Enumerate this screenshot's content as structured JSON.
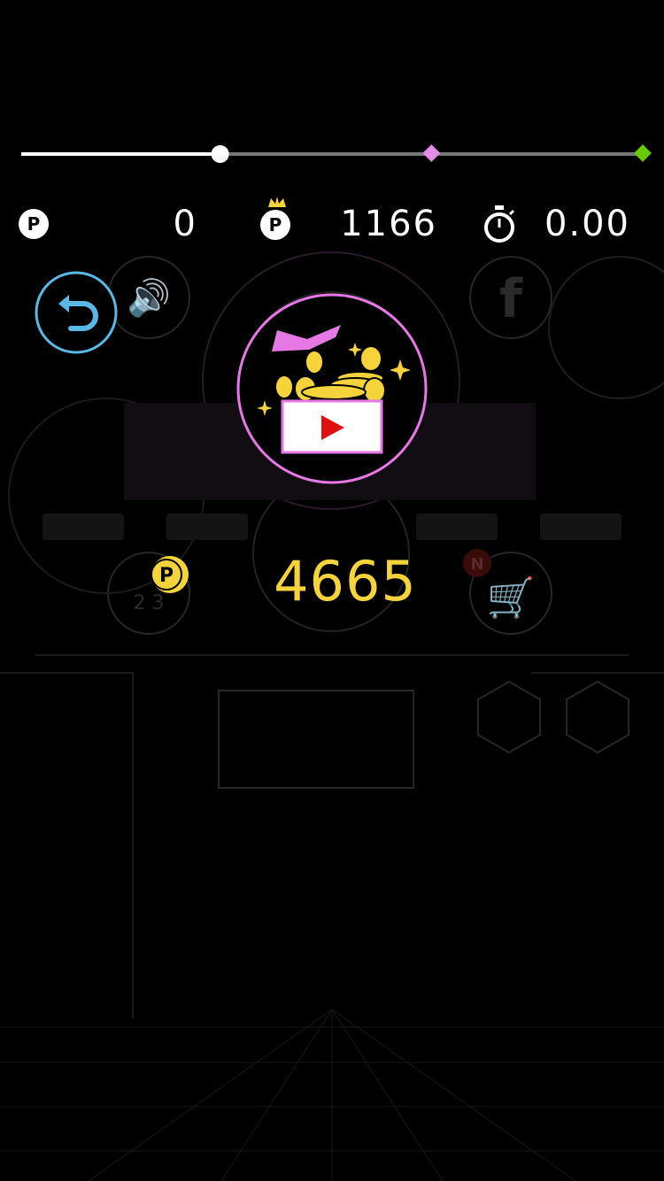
{
  "progress": {
    "value": 0.32,
    "marker_mid": 0.66,
    "marker_end": 1.0,
    "track_color": "#777777",
    "fill_color": "#ffffff",
    "mid_color": "#e68ce6",
    "end_color": "#66cc00"
  },
  "stats": {
    "points": "0",
    "best_points": "1166",
    "time": "0.00"
  },
  "coins": {
    "total": "4665",
    "color": "#f5d33a"
  },
  "icons": {
    "back": "undo-arrow-icon",
    "reward": "gift-video-icon",
    "sound": "speaker-icon",
    "facebook": "facebook-icon",
    "replay": "replay-icon",
    "cart": "cart-icon",
    "ranking": "podium-icon",
    "timer": "stopwatch-icon"
  },
  "badges": {
    "cart_badge": "N",
    "ranking_numbers": "2 3"
  },
  "accents": {
    "back_ring": "#5ab8e6",
    "reward_ring": "#e678e6",
    "play_red": "#e01010"
  }
}
